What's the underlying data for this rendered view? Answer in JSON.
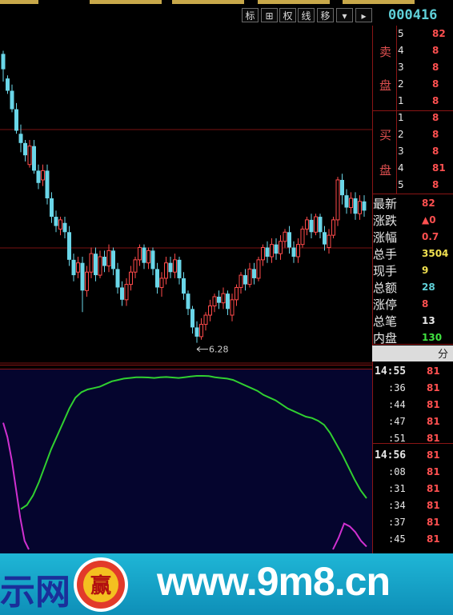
{
  "toolbar": {
    "buttons": [
      {
        "label": "标"
      },
      {
        "label": "⊞"
      },
      {
        "label": "权"
      },
      {
        "label": "线"
      },
      {
        "label": "移"
      },
      {
        "label": "▾"
      },
      {
        "label": "▸"
      }
    ],
    "stock_code": "000416"
  },
  "kline": {
    "low_marker": "6.28",
    "candles": [
      [
        8.06,
        8.16,
        7.98,
        8.18,
        "down"
      ],
      [
        8.0,
        7.92,
        7.9,
        8.02,
        "down"
      ],
      [
        7.92,
        7.8,
        7.78,
        7.96,
        "down"
      ],
      [
        7.8,
        7.66,
        7.64,
        7.84,
        "down"
      ],
      [
        7.64,
        7.58,
        7.52,
        7.7,
        "down"
      ],
      [
        7.58,
        7.5,
        7.46,
        7.6,
        "down"
      ],
      [
        7.44,
        7.56,
        7.42,
        7.6,
        "up"
      ],
      [
        7.56,
        7.4,
        7.38,
        7.6,
        "down"
      ],
      [
        7.4,
        7.32,
        7.28,
        7.44,
        "down"
      ],
      [
        7.34,
        7.4,
        7.3,
        7.44,
        "up"
      ],
      [
        7.4,
        7.22,
        7.18,
        7.44,
        "down"
      ],
      [
        7.22,
        7.1,
        7.06,
        7.26,
        "down"
      ],
      [
        7.1,
        7.04,
        7.0,
        7.14,
        "down"
      ],
      [
        7.02,
        7.08,
        6.98,
        7.1,
        "up"
      ],
      [
        7.06,
        7.0,
        6.96,
        7.1,
        "down"
      ],
      [
        7.0,
        6.82,
        6.78,
        7.04,
        "down"
      ],
      [
        6.82,
        6.72,
        6.68,
        6.86,
        "down"
      ],
      [
        6.74,
        6.8,
        6.7,
        6.84,
        "up"
      ],
      [
        6.8,
        6.62,
        6.48,
        6.84,
        "down"
      ],
      [
        6.62,
        6.74,
        6.58,
        6.78,
        "up"
      ],
      [
        6.74,
        6.86,
        6.7,
        6.9,
        "up"
      ],
      [
        6.86,
        6.72,
        6.68,
        6.9,
        "down"
      ],
      [
        6.72,
        6.84,
        6.7,
        6.88,
        "up"
      ],
      [
        6.84,
        6.78,
        6.74,
        6.88,
        "down"
      ],
      [
        6.78,
        6.88,
        6.74,
        6.92,
        "up"
      ],
      [
        6.88,
        6.76,
        6.72,
        6.9,
        "down"
      ],
      [
        6.76,
        6.64,
        6.6,
        6.8,
        "down"
      ],
      [
        6.64,
        6.56,
        6.52,
        6.68,
        "down"
      ],
      [
        6.56,
        6.66,
        6.52,
        6.7,
        "up"
      ],
      [
        6.66,
        6.74,
        6.62,
        6.78,
        "up"
      ],
      [
        6.74,
        6.82,
        6.7,
        6.84,
        "up"
      ],
      [
        6.82,
        6.9,
        6.78,
        6.92,
        "up"
      ],
      [
        6.9,
        6.8,
        6.76,
        6.92,
        "down"
      ],
      [
        6.8,
        6.88,
        6.76,
        6.9,
        "up"
      ],
      [
        6.88,
        6.76,
        6.72,
        6.9,
        "down"
      ],
      [
        6.76,
        6.64,
        6.6,
        6.8,
        "down"
      ],
      [
        6.64,
        6.7,
        6.58,
        6.74,
        "up"
      ],
      [
        6.7,
        6.8,
        6.66,
        6.84,
        "up"
      ],
      [
        6.8,
        6.74,
        6.7,
        6.84,
        "down"
      ],
      [
        6.74,
        6.82,
        6.7,
        6.86,
        "up"
      ],
      [
        6.82,
        6.7,
        6.66,
        6.84,
        "down"
      ],
      [
        6.7,
        6.6,
        6.56,
        6.74,
        "down"
      ],
      [
        6.6,
        6.5,
        6.46,
        6.62,
        "down"
      ],
      [
        6.5,
        6.38,
        6.34,
        6.52,
        "down"
      ],
      [
        6.38,
        6.32,
        6.28,
        6.42,
        "down"
      ],
      [
        6.32,
        6.4,
        6.3,
        6.44,
        "up"
      ],
      [
        6.4,
        6.46,
        6.36,
        6.48,
        "up"
      ],
      [
        6.46,
        6.52,
        6.42,
        6.56,
        "up"
      ],
      [
        6.52,
        6.58,
        6.48,
        6.6,
        "up"
      ],
      [
        6.58,
        6.54,
        6.5,
        6.62,
        "down"
      ],
      [
        6.54,
        6.6,
        6.5,
        6.64,
        "up"
      ],
      [
        6.6,
        6.5,
        6.46,
        6.62,
        "down"
      ],
      [
        6.46,
        6.56,
        6.42,
        6.6,
        "up"
      ],
      [
        6.56,
        6.64,
        6.52,
        6.66,
        "up"
      ],
      [
        6.64,
        6.72,
        6.6,
        6.74,
        "up"
      ],
      [
        6.72,
        6.66,
        6.62,
        6.76,
        "down"
      ],
      [
        6.66,
        6.76,
        6.64,
        6.8,
        "up"
      ],
      [
        6.76,
        6.7,
        6.66,
        6.8,
        "down"
      ],
      [
        6.7,
        6.82,
        6.68,
        6.84,
        "up"
      ],
      [
        6.82,
        6.9,
        6.78,
        6.92,
        "up"
      ],
      [
        6.9,
        6.84,
        6.8,
        6.94,
        "down"
      ],
      [
        6.84,
        6.92,
        6.8,
        6.96,
        "up"
      ],
      [
        6.92,
        6.86,
        6.82,
        6.96,
        "down"
      ],
      [
        6.86,
        6.94,
        6.82,
        6.98,
        "up"
      ],
      [
        6.94,
        7.0,
        6.9,
        7.02,
        "up"
      ],
      [
        7.0,
        6.9,
        6.86,
        7.04,
        "down"
      ],
      [
        6.9,
        6.84,
        6.8,
        6.94,
        "down"
      ],
      [
        6.84,
        6.92,
        6.8,
        6.96,
        "up"
      ],
      [
        6.92,
        7.02,
        6.9,
        7.04,
        "up"
      ],
      [
        7.02,
        7.08,
        6.98,
        7.1,
        "up"
      ],
      [
        7.08,
        7.0,
        6.96,
        7.12,
        "down"
      ],
      [
        7.0,
        7.1,
        6.98,
        7.12,
        "up"
      ],
      [
        7.1,
        7.0,
        6.96,
        7.12,
        "down"
      ],
      [
        7.0,
        6.92,
        6.88,
        7.04,
        "down"
      ],
      [
        6.9,
        6.98,
        6.86,
        7.02,
        "up"
      ],
      [
        6.98,
        7.08,
        6.96,
        7.1,
        "up"
      ],
      [
        7.08,
        7.34,
        7.04,
        7.36,
        "up"
      ],
      [
        7.34,
        7.24,
        7.18,
        7.38,
        "down"
      ],
      [
        7.24,
        7.16,
        7.12,
        7.28,
        "down"
      ],
      [
        7.16,
        7.22,
        7.12,
        7.26,
        "up"
      ],
      [
        7.22,
        7.12,
        7.08,
        7.26,
        "down"
      ],
      [
        7.12,
        7.2,
        7.08,
        7.24,
        "up"
      ],
      [
        7.2,
        7.14,
        7.1,
        7.24,
        "down"
      ]
    ]
  },
  "indicator": {
    "green": [
      0.02,
      0.05,
      0.12,
      0.22,
      0.34,
      0.46,
      0.56,
      0.66,
      0.76,
      0.84,
      0.88,
      0.9,
      0.91,
      0.92,
      0.94,
      0.96,
      0.97,
      0.98,
      0.985,
      0.99,
      0.99,
      0.988,
      0.985,
      0.99,
      0.992,
      0.988,
      0.985,
      0.99,
      0.995,
      1.0,
      1.0,
      0.998,
      0.99,
      0.985,
      0.98,
      0.97,
      0.95,
      0.93,
      0.91,
      0.89,
      0.86,
      0.84,
      0.82,
      0.79,
      0.76,
      0.74,
      0.72,
      0.7,
      0.69,
      0.67,
      0.64,
      0.58,
      0.5,
      0.42,
      0.33,
      0.24,
      0.16,
      0.1
    ],
    "magenta_left": [
      0.88,
      0.78,
      0.62,
      0.42,
      0.22,
      0.06,
      0.0
    ],
    "magenta_right": [
      0.0,
      0.08,
      0.18,
      0.16,
      0.12,
      0.06,
      0.02
    ]
  },
  "orderbook": {
    "sell_label_1": "卖",
    "sell_label_2": "盘",
    "buy_label_1": "买",
    "buy_label_2": "盘",
    "sell": [
      {
        "level": "5",
        "price": "82"
      },
      {
        "level": "4",
        "price": "8"
      },
      {
        "level": "3",
        "price": "8"
      },
      {
        "level": "2",
        "price": "8"
      },
      {
        "level": "1",
        "price": "8"
      }
    ],
    "buy": [
      {
        "level": "1",
        "price": "8"
      },
      {
        "level": "2",
        "price": "8"
      },
      {
        "level": "3",
        "price": "8"
      },
      {
        "level": "4",
        "price": "81"
      },
      {
        "level": "5",
        "price": "8"
      }
    ]
  },
  "stats": [
    {
      "label": "最新",
      "value": "82",
      "color": "#ff5050"
    },
    {
      "label": "涨跌",
      "value": "▲0",
      "color": "#ff5050"
    },
    {
      "label": "涨幅",
      "value": "0.7",
      "color": "#ff5050"
    },
    {
      "label": "总手",
      "value": "3504",
      "color": "#f0e050"
    },
    {
      "label": "现手",
      "value": "9",
      "color": "#f0e050"
    },
    {
      "label": "总额",
      "value": "28",
      "color": "#5fd0d8"
    },
    {
      "label": "涨停",
      "value": "8",
      "color": "#ff5050"
    },
    {
      "label": "总笔",
      "value": "13",
      "color": "#e8e8e8"
    },
    {
      "label": "内盘",
      "value": "130",
      "color": "#40e040"
    }
  ],
  "ticks_header": "分",
  "ticks": [
    {
      "time": "14:55",
      "price": "81",
      "big": true
    },
    {
      "time": ":36",
      "price": "81",
      "big": false
    },
    {
      "time": ":44",
      "price": "81",
      "big": false
    },
    {
      "time": ":47",
      "price": "81",
      "big": false
    },
    {
      "time": ":51",
      "price": "81",
      "big": false
    },
    {
      "time": "14:56",
      "price": "81",
      "big": true
    },
    {
      "time": ":08",
      "price": "81",
      "big": false
    },
    {
      "time": ":31",
      "price": "81",
      "big": false
    },
    {
      "time": ":34",
      "price": "81",
      "big": false
    },
    {
      "time": ":37",
      "price": "81",
      "big": false
    },
    {
      "time": ":45",
      "price": "81",
      "big": false
    }
  ],
  "watermark": {
    "left_text": "示网",
    "url": "www.9m8.cn",
    "logo_char": "赢"
  }
}
